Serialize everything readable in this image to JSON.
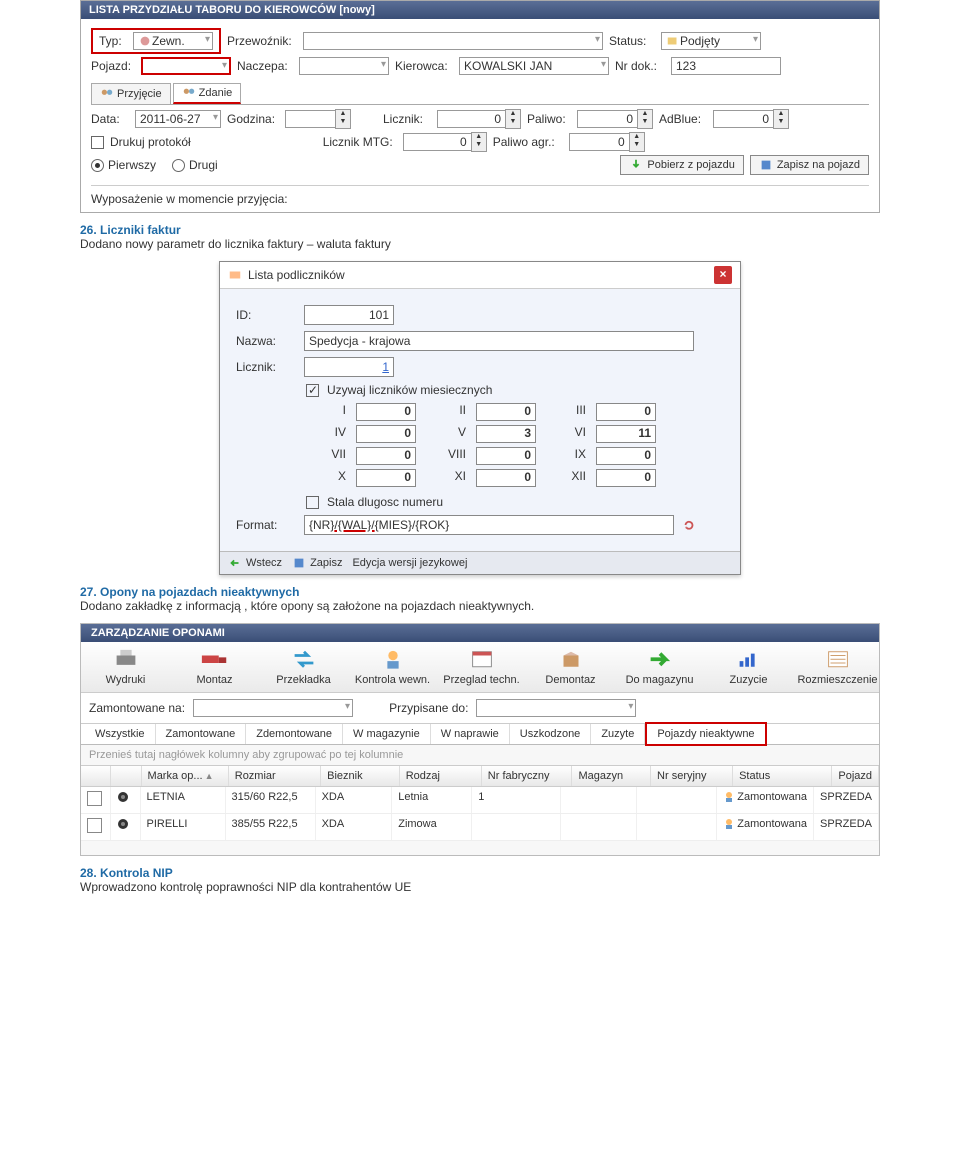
{
  "window1": {
    "title": "LISTA PRZYDZIAŁU TABORU DO KIEROWCÓW  [nowy]",
    "row1": {
      "typ_label": "Typ:",
      "typ_value": "Zewn.",
      "przewoznik_label": "Przewoźnik:",
      "przewoznik_value": "",
      "status_label": "Status:",
      "status_value": "Podjęty"
    },
    "row2": {
      "pojazd_label": "Pojazd:",
      "pojazd_value": "",
      "naczepa_label": "Naczepa:",
      "naczepa_value": "",
      "kierowca_label": "Kierowca:",
      "kierowca_value": "KOWALSKI JAN",
      "nrdok_label": "Nr dok.:",
      "nrdok_value": "123"
    },
    "tabs": {
      "przyjecie": "Przyjęcie",
      "zdanie": "Zdanie"
    },
    "row3": {
      "data_label": "Data:",
      "data_value": "2011-06-27",
      "godzina_label": "Godzina:",
      "godzina_value": "",
      "licznik_label": "Licznik:",
      "licznik_value": "0",
      "paliwo_label": "Paliwo:",
      "paliwo_value": "0",
      "adblue_label": "AdBlue:",
      "adblue_value": "0"
    },
    "row4": {
      "drukuj": "Drukuj protokół",
      "licznikmtg_label": "Licznik MTG:",
      "licznikmtg_value": "0",
      "paliwoagr_label": "Paliwo agr.:",
      "paliwoagr_value": "0"
    },
    "row5": {
      "pierwszy": "Pierwszy",
      "drugi": "Drugi"
    },
    "btns": {
      "pobierz": "Pobierz z pojazdu",
      "zapisz": "Zapisz na pojazd"
    },
    "footer": "Wyposażenie w momencie przyjęcia:"
  },
  "section26": {
    "num": "26.",
    "title": "Liczniki faktur",
    "body": "Dodano nowy parametr do licznika faktury – waluta faktury"
  },
  "dialog": {
    "title": "Lista podliczników",
    "id_label": "ID:",
    "id_value": "101",
    "nazwa_label": "Nazwa:",
    "nazwa_value": "Spedycja - krajowa",
    "licznik_label": "Licznik:",
    "licznik_value": "1",
    "uzywaj": "Uzywaj liczników miesiecznych",
    "months": {
      "I": "0",
      "II": "0",
      "III": "0",
      "IV": "0",
      "V": "3",
      "VI": "11",
      "VII": "0",
      "VIII": "0",
      "IX": "0",
      "X": "0",
      "XI": "0",
      "XII": "0"
    },
    "stala": "Stala dlugosc numeru",
    "format_label": "Format:",
    "format_pre": "{NR}",
    "format_mid": "/{WAL}/",
    "format_post": "{MIES}/{ROK}",
    "foot": {
      "wstecz": "Wstecz",
      "zapisz": "Zapisz",
      "edycja": "Edycja wersji jezykowej"
    }
  },
  "section27": {
    "num": "27.",
    "title": "Opony na pojazdach nieaktywnych",
    "body": "Dodano zakładkę z informacją , które opony są założone na pojazdach nieaktywnych."
  },
  "tires": {
    "title": "ZARZĄDZANIE OPONAMI",
    "toolbar": [
      "Wydruki",
      "Montaz",
      "Przekładka",
      "Kontrola wewn.",
      "Przeglad techn.",
      "Demontaz",
      "Do magazynu",
      "Zuzycie",
      "Rozmieszczenie"
    ],
    "filter": {
      "zamont_label": "Zamontowane na:",
      "zamont_value": "",
      "przyp_label": "Przypisane do:",
      "przyp_value": ""
    },
    "subtabs": [
      "Wszystkie",
      "Zamontowane",
      "Zdemontowane",
      "W magazynie",
      "W naprawie",
      "Uszkodzone",
      "Zuzyte",
      "Pojazdy nieaktywne"
    ],
    "group_text": "Przenieś tutaj nagłówek kolumny aby zgrupować po tej kolumnie",
    "cols": [
      "",
      "",
      "Marka op...",
      "Rozmiar",
      "Bieznik",
      "Rodzaj",
      "Nr fabryczny",
      "Magazyn",
      "Nr seryjny",
      "Status",
      "Pojazd"
    ],
    "rows": [
      {
        "marka": "LETNIA",
        "rozmiar": "315/60 R22,5",
        "bieznik": "XDA",
        "rodzaj": "Letnia",
        "nrfab": "1",
        "magazyn": "",
        "nrser": "",
        "status": "Zamontowana",
        "pojazd": "SPRZEDA"
      },
      {
        "marka": "PIRELLI",
        "rozmiar": "385/55 R22,5",
        "bieznik": "XDA",
        "rodzaj": "Zimowa",
        "nrfab": "",
        "magazyn": "",
        "nrser": "",
        "status": "Zamontowana",
        "pojazd": "SPRZEDA"
      }
    ]
  },
  "section28": {
    "num": "28.",
    "title": "Kontrola NIP",
    "body": "Wprowadzono kontrolę poprawności NIP dla kontrahentów UE"
  }
}
